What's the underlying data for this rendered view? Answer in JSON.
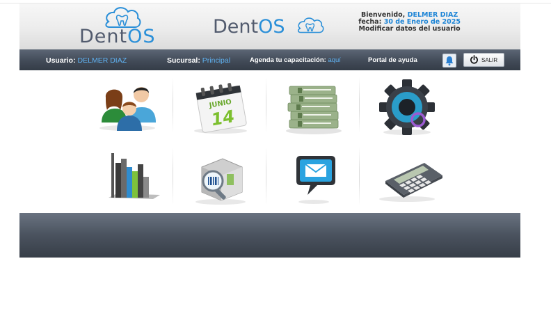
{
  "header": {
    "logo_text_main": "Dent",
    "logo_text_accent": "OS",
    "welcome_prefix": "Bienvenido,",
    "welcome_user": "DELMER DIAZ",
    "date_prefix": "fecha:",
    "date_value": "30 de Enero de 2025",
    "modify_link": "Modificar datos del usuario"
  },
  "navbar": {
    "user_label": "Usuario:",
    "user_value": "DELMER DIAZ",
    "branch_label": "Sucursal:",
    "branch_value": "Principal",
    "training_label": "Agenda tu capacitación:",
    "training_link": "aquí",
    "help_link": "Portal de ayuda",
    "logout_label": "SALIR"
  },
  "calendar_icon": {
    "month": "JUNIO",
    "day": "14"
  },
  "tiles": [
    {
      "icon": "patients-icon"
    },
    {
      "icon": "calendar-icon"
    },
    {
      "icon": "money-icon"
    },
    {
      "icon": "settings-gear-icon"
    },
    {
      "icon": "reports-chart-icon"
    },
    {
      "icon": "inventory-scanner-icon"
    },
    {
      "icon": "messages-icon"
    },
    {
      "icon": "calculator-icon"
    }
  ],
  "colors": {
    "accent": "#2a8fd8",
    "nav_bg": "#424b58",
    "link": "#5fb2f2"
  }
}
